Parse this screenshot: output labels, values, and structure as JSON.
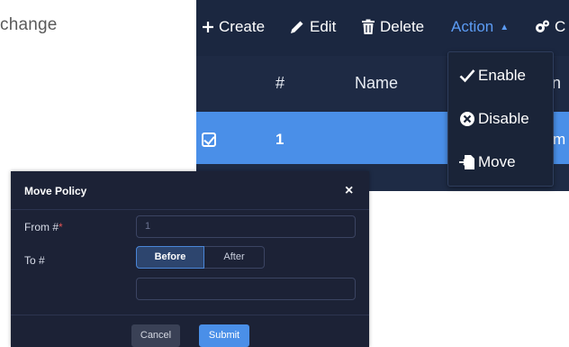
{
  "background": {
    "text": "change"
  },
  "toolbar": {
    "create": "Create",
    "edit": "Edit",
    "delete": "Delete",
    "action": "Action",
    "gear_partial": "C"
  },
  "table": {
    "headers": {
      "num": "#",
      "name": "Name",
      "partial": "n"
    },
    "rows": [
      {
        "selected": true,
        "num": "1",
        "partial": "m"
      }
    ]
  },
  "action_menu": {
    "items": [
      {
        "label": "Enable",
        "icon": "check-icon"
      },
      {
        "label": "Disable",
        "icon": "times-circle-icon"
      },
      {
        "label": "Move",
        "icon": "move-file-icon"
      }
    ]
  },
  "modal": {
    "title": "Move Policy",
    "close": "×",
    "from_label": "From #",
    "required_mark": "*",
    "from_placeholder": "1",
    "to_label": "To #",
    "before": "Before",
    "after": "After",
    "cancel": "Cancel",
    "submit": "Submit"
  },
  "colors": {
    "accent": "#4a8fe8",
    "action_link": "#5c9cf5",
    "toolbar_bg": "#1b2740",
    "modal_bg": "#1c2236",
    "required": "#e05252"
  }
}
